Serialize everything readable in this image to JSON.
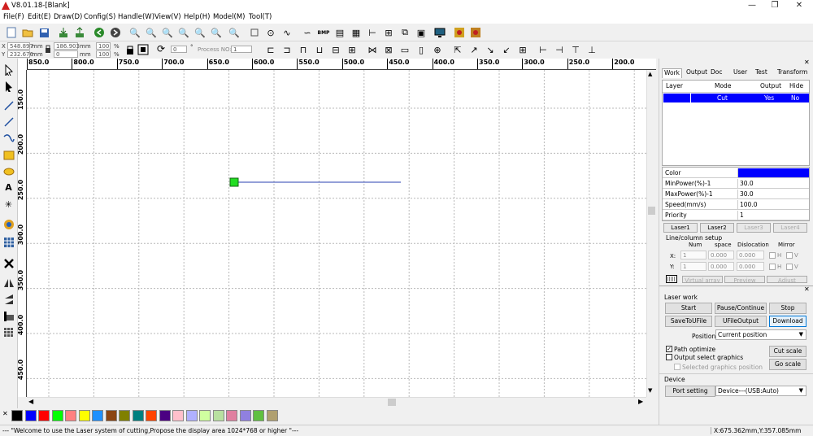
{
  "window": {
    "title": "V8.01.18-[Blank]"
  },
  "menu": [
    "File(F)",
    "Edit(E)",
    "Draw(D)",
    "Config(S)",
    "Handle(W)",
    "View(V)",
    "Help(H)",
    "Model(M)",
    "Tool(T)"
  ],
  "position_box": {
    "x_label": "X",
    "y_label": "Y",
    "x_value": "548.897",
    "y_value": "232.676",
    "x_unit": "mm",
    "y_unit": "mm",
    "w_value": "186.903",
    "h_value": "0",
    "w_unit": "mm",
    "h_unit": "mm",
    "scale_x": "100",
    "scale_y": "100",
    "pct1": "%",
    "pct2": "%",
    "rotate_value": "0",
    "process_no_label": "Process NO:",
    "process_no_value": "1"
  },
  "ruler_h": [
    "850.0",
    "800.0",
    "750.0",
    "700.0",
    "650.0",
    "600.0",
    "550.0",
    "500.0",
    "450.0",
    "400.0",
    "350.0",
    "300.0",
    "250.0",
    "200.0"
  ],
  "ruler_v": [
    "150.0",
    "200.0",
    "250.0",
    "300.0",
    "350.0",
    "400.0",
    "450.0"
  ],
  "palette": [
    "#000000",
    "#0000ff",
    "#ff0000",
    "#00ff00",
    "#ff8080",
    "#ffff00",
    "#1e90ff",
    "#8b4513",
    "#808000",
    "#008080",
    "#ff4500",
    "#4b0082",
    "#ffc0cb",
    "#b0b0ff",
    "#d0ffa0",
    "#b8e0a0",
    "#e080a0",
    "#9080e0",
    "#60c040",
    "#b0a070"
  ],
  "status": {
    "message": "--- \"Welcome to use the Laser system of cutting,Propose the display area 1024*768 or higher \"---",
    "coords": "X:675.362mm,Y:357.085mm"
  },
  "panel": {
    "tabs": [
      "Work",
      "Output",
      "Doc",
      "User",
      "Test",
      "Transform"
    ],
    "layer_headers": [
      "Layer",
      "Mode",
      "Output",
      "Hide"
    ],
    "layer_row": {
      "mode": "Cut",
      "output": "Yes",
      "hide": "No",
      "color": "#0000ff"
    },
    "props": [
      {
        "label": "Color",
        "value": ""
      },
      {
        "label": "MinPower(%)-1",
        "value": "30.0"
      },
      {
        "label": "MaxPower(%)-1",
        "value": "30.0"
      },
      {
        "label": "Speed(mm/s)",
        "value": "100.0"
      },
      {
        "label": "Priority",
        "value": "1"
      }
    ],
    "laser_buttons": [
      "Laser1",
      "Laser2",
      "Laser3",
      "Laser4"
    ],
    "line_column": {
      "title": "Line/column setup",
      "h_num": "Num",
      "h_space": "space",
      "h_disloc": "Dislocation",
      "h_mirror": "Mirror",
      "x_label": "X:",
      "y_label": "Y:",
      "x_num": "1",
      "x_space": "0.000",
      "x_disloc": "0.000",
      "y_num": "1",
      "y_space": "0.000",
      "y_disloc": "0.000",
      "h": "H",
      "v": "V",
      "virtual_array": "Virtual array",
      "preview": "Preview",
      "adjust": "Adjust"
    },
    "laser_work": {
      "title": "Laser work",
      "start": "Start",
      "pause": "Pause/Continue",
      "stop": "Stop",
      "save_to_ufile": "SaveToUFile",
      "ufile_output": "UFileOutput",
      "download": "Download",
      "position_label": "Position:",
      "position_value": "Current position",
      "path_optimize": "Path optimize",
      "output_select": "Output select graphics",
      "selected_position": "Selected graphics position",
      "cut_scale": "Cut scale",
      "go_scale": "Go scale"
    },
    "device": {
      "title": "Device",
      "port_setting": "Port setting",
      "device_value": "Device---(USB:Auto)"
    }
  }
}
